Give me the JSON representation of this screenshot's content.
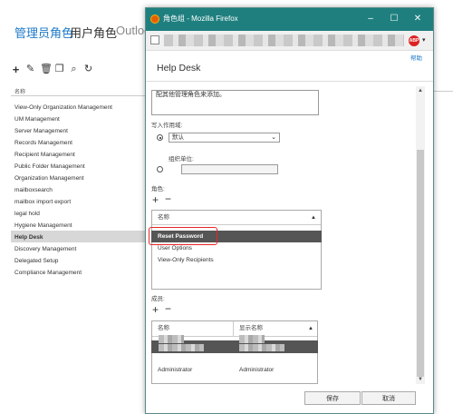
{
  "background": {
    "tabs": [
      {
        "label": "管理员角色"
      },
      {
        "label": "用户角色"
      },
      {
        "label": "Outloo"
      }
    ],
    "column_header": "名称",
    "roles": [
      "View-Only Organization Management",
      "UM Management",
      "Server Management",
      "Records Management",
      "Recipient Management",
      "Public Folder Management",
      "Organization Management",
      "mailboxsearch",
      "mailbox import export",
      "legal hold",
      "Hygiene Management",
      "Help Desk",
      "Discovery Management",
      "Delegated Setup",
      "Compliance Management"
    ],
    "selected_role": "Help Desk",
    "toolbar_icons": [
      "add-icon",
      "edit-icon",
      "delete-icon",
      "copy-icon",
      "search-icon",
      "refresh-icon"
    ]
  },
  "window": {
    "title": "角色组 - Mozilla Firefox",
    "ext_badge": "ABP",
    "help": "帮助",
    "dialog_title": "Help Desk",
    "description_text": "配其他管理角色来添加。",
    "write_scope_label": "写入作用域:",
    "write_scope_value": "默认",
    "ou_label": "组织单位:",
    "roles_label": "角色:",
    "roles_column": "名称",
    "roles": [
      {
        "name": "Reset Password",
        "selected": true
      },
      {
        "name": "User Options",
        "selected": false
      },
      {
        "name": "View-Only Recipients",
        "selected": false
      }
    ],
    "members_label": "成员:",
    "members_columns": {
      "name": "名称",
      "display_name": "显示名称"
    },
    "members": [
      {
        "name": "",
        "display_name": "",
        "selected": true,
        "redacted": true
      },
      {
        "name": "Administrator",
        "display_name": "Administrator",
        "selected": false,
        "redacted": false
      }
    ],
    "save_label": "保存",
    "cancel_label": "取消"
  },
  "colors": {
    "accent_blue": "#1e7ac8",
    "titlebar": "#1f7f7f",
    "selection": "#555555",
    "highlight_red": "#e8262a"
  }
}
